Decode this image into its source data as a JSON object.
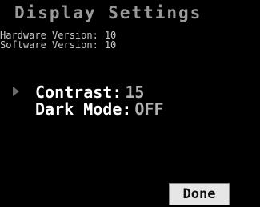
{
  "title": "Display Settings",
  "info": {
    "hardware_label": "Hardware Version:",
    "hardware_value": "10",
    "software_label": "Software Version:",
    "software_value": "10"
  },
  "menu": {
    "items": [
      {
        "label": "Contrast:",
        "value": "15",
        "selected": true
      },
      {
        "label": "Dark Mode:",
        "value": "OFF",
        "selected": false
      }
    ]
  },
  "buttons": {
    "done_label": "Done"
  },
  "colors": {
    "background": "#000000",
    "title": "#9a9a9a",
    "menu_label": "#ffffff",
    "menu_value": "#b0b0b0",
    "button_bg": "#e6e6e6"
  }
}
